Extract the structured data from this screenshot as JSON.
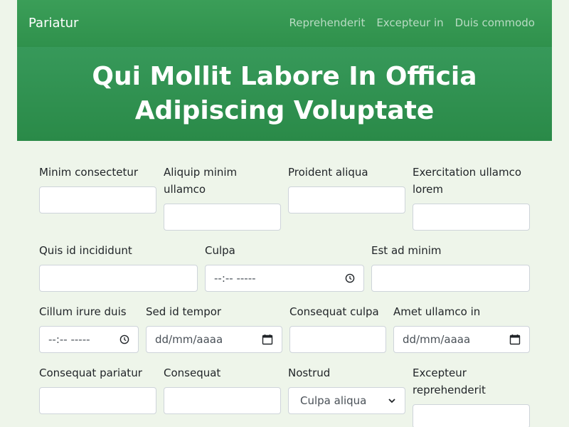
{
  "navbar": {
    "brand": "Pariatur",
    "links": [
      "Reprehenderit",
      "Excepteur in",
      "Duis commodo"
    ]
  },
  "hero": {
    "title": "Qui Mollit Labore In Officia Adipiscing Voluptate"
  },
  "form": {
    "row1": {
      "f1": {
        "label": "Minim consectetur",
        "value": ""
      },
      "f2": {
        "label": "Aliquip minim ullamco",
        "value": ""
      },
      "f3": {
        "label": "Proident aliqua",
        "value": ""
      },
      "f4": {
        "label": "Exercitation ullamco lorem",
        "value": ""
      }
    },
    "row2": {
      "f1": {
        "label": "Quis id incididunt",
        "value": ""
      },
      "f2": {
        "label": "Culpa",
        "placeholder": "--:-- -----"
      },
      "f3": {
        "label": "Est ad minim",
        "value": ""
      }
    },
    "row3": {
      "f1": {
        "label": "Cillum irure duis",
        "placeholder": "--:-- -----"
      },
      "f2": {
        "label": "Sed id tempor",
        "placeholder": "dd/mm/aaaa"
      },
      "f3": {
        "label": "Consequat culpa",
        "value": ""
      },
      "f4": {
        "label": "Amet ullamco in",
        "placeholder": "dd/mm/aaaa"
      }
    },
    "row4": {
      "f1": {
        "label": "Consequat pariatur",
        "value": ""
      },
      "f2": {
        "label": "Consequat",
        "value": ""
      },
      "f3": {
        "label": "Nostrud",
        "selected": "Culpa aliqua"
      },
      "f4": {
        "label": "Excepteur reprehenderit",
        "value": ""
      }
    }
  },
  "icons": {
    "time": "clock-icon",
    "date": "calendar-icon",
    "select": "chevron-down-icon"
  },
  "colors": {
    "accent": "#2f914c",
    "background": "#eef5ea"
  }
}
